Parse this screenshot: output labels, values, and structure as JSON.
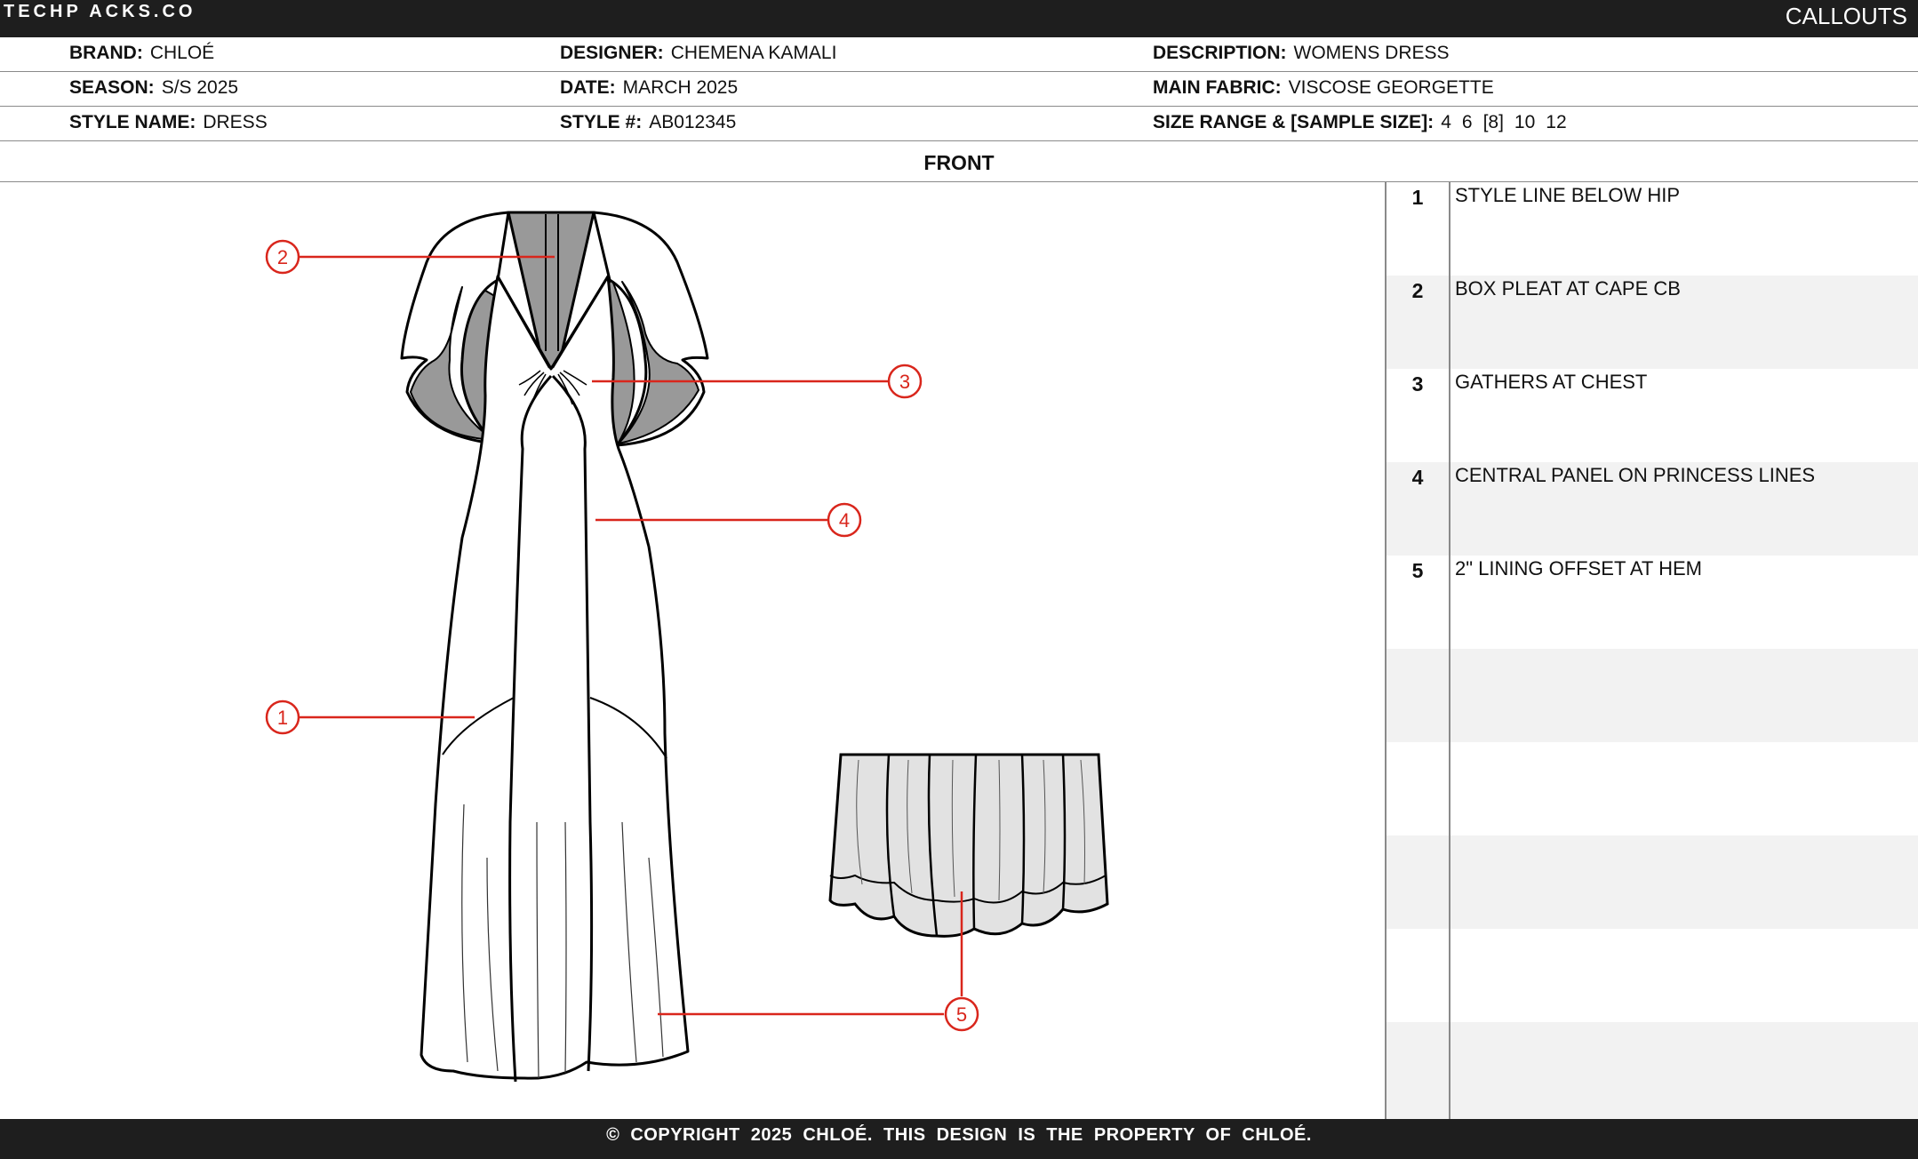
{
  "header": {
    "logo": "TECHP ACKS.CO",
    "title": "CALLOUTS"
  },
  "info": {
    "brand_label": "BRAND:",
    "brand": "CHLOÉ",
    "designer_label": "DESIGNER:",
    "designer": "CHEMENA KAMALI",
    "description_label": "DESCRIPTION:",
    "description": "WOMENS DRESS",
    "season_label": "SEASON:",
    "season": "S/S 2025",
    "date_label": "DATE:",
    "date": "MARCH 2025",
    "fabric_label": "MAIN FABRIC:",
    "fabric": "VISCOSE GEORGETTE",
    "style_name_label": "STYLE NAME:",
    "style_name": "DRESS",
    "style_no_label": "STYLE #:",
    "style_no": "AB012345",
    "size_label": "SIZE RANGE & [SAMPLE SIZE]:",
    "sizes": [
      "4",
      "6",
      "[8]",
      "10",
      "12"
    ]
  },
  "view_label": "FRONT",
  "drawing": {
    "markers": [
      "1",
      "2",
      "3",
      "4",
      "5"
    ],
    "line_color": "#d9261c",
    "panel_gray": "#999999",
    "lining_gray": "#e2e2e2"
  },
  "callouts": [
    {
      "num": "1",
      "text": "STYLE LINE BELOW HIP"
    },
    {
      "num": "2",
      "text": "BOX PLEAT AT CAPE CB"
    },
    {
      "num": "3",
      "text": "GATHERS AT CHEST"
    },
    {
      "num": "4",
      "text": "CENTRAL PANEL ON PRINCESS LINES"
    },
    {
      "num": "5",
      "text": "2\" LINING OFFSET AT HEM"
    },
    {
      "num": "",
      "text": ""
    },
    {
      "num": "",
      "text": ""
    },
    {
      "num": "",
      "text": ""
    },
    {
      "num": "",
      "text": ""
    },
    {
      "num": "",
      "text": ""
    }
  ],
  "footer": "© COPYRIGHT 2025 CHLOÉ.  THIS DESIGN IS THE PROPERTY OF CHLOÉ."
}
